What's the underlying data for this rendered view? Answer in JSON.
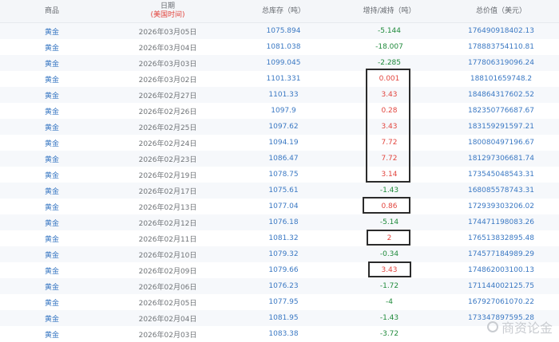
{
  "header": {
    "product": "商品",
    "date": "日期",
    "date_sub": "(美国时间)",
    "holdings": "总库存（吨）",
    "change": "增持/减持（吨）",
    "value": "总价值（美元）"
  },
  "rows": [
    {
      "product": "黄金",
      "date": "2026年03月05日",
      "holdings": "1075.894",
      "change": "-5.144",
      "value": "176490918402.13"
    },
    {
      "product": "黄金",
      "date": "2026年03月04日",
      "holdings": "1081.038",
      "change": "-18.007",
      "value": "178883754110.81"
    },
    {
      "product": "黄金",
      "date": "2026年03月03日",
      "holdings": "1099.045",
      "change": "-2.285",
      "value": "177806319096.24"
    },
    {
      "product": "黄金",
      "date": "2026年03月02日",
      "holdings": "1101.331",
      "change": "0.001",
      "value": "188101659748.2"
    },
    {
      "product": "黄金",
      "date": "2026年02月27日",
      "holdings": "1101.33",
      "change": "3.43",
      "value": "184864317602.52"
    },
    {
      "product": "黄金",
      "date": "2026年02月26日",
      "holdings": "1097.9",
      "change": "0.28",
      "value": "182350776687.67"
    },
    {
      "product": "黄金",
      "date": "2026年02月25日",
      "holdings": "1097.62",
      "change": "3.43",
      "value": "183159291597.21"
    },
    {
      "product": "黄金",
      "date": "2026年02月24日",
      "holdings": "1094.19",
      "change": "7.72",
      "value": "180080497196.67"
    },
    {
      "product": "黄金",
      "date": "2026年02月23日",
      "holdings": "1086.47",
      "change": "7.72",
      "value": "181297306681.74"
    },
    {
      "product": "黄金",
      "date": "2026年02月19日",
      "holdings": "1078.75",
      "change": "3.14",
      "value": "173545048543.31"
    },
    {
      "product": "黄金",
      "date": "2026年02月17日",
      "holdings": "1075.61",
      "change": "-1.43",
      "value": "168085578743.31"
    },
    {
      "product": "黄金",
      "date": "2026年02月13日",
      "holdings": "1077.04",
      "change": "0.86",
      "value": "172939303206.02"
    },
    {
      "product": "黄金",
      "date": "2026年02月12日",
      "holdings": "1076.18",
      "change": "-5.14",
      "value": "174471198083.26"
    },
    {
      "product": "黄金",
      "date": "2026年02月11日",
      "holdings": "1081.32",
      "change": "2",
      "value": "176513832895.48"
    },
    {
      "product": "黄金",
      "date": "2026年02月10日",
      "holdings": "1079.32",
      "change": "-0.34",
      "value": "174577184989.29"
    },
    {
      "product": "黄金",
      "date": "2026年02月09日",
      "holdings": "1079.66",
      "change": "3.43",
      "value": "174862003100.13"
    },
    {
      "product": "黄金",
      "date": "2026年02月06日",
      "holdings": "1076.23",
      "change": "-1.72",
      "value": "171144002125.75"
    },
    {
      "product": "黄金",
      "date": "2026年02月05日",
      "holdings": "1077.95",
      "change": "-4",
      "value": "167927061070.22"
    },
    {
      "product": "黄金",
      "date": "2026年02月04日",
      "holdings": "1081.95",
      "change": "-1.43",
      "value": "173347897595.28"
    },
    {
      "product": "黄金",
      "date": "2026年02月03日",
      "holdings": "1083.38",
      "change": "-3.72",
      "value": ""
    }
  ],
  "watermark": "商资论金",
  "colors": {
    "up": "#e2463f",
    "down": "#1f8a3b",
    "link": "#3a78c3"
  }
}
